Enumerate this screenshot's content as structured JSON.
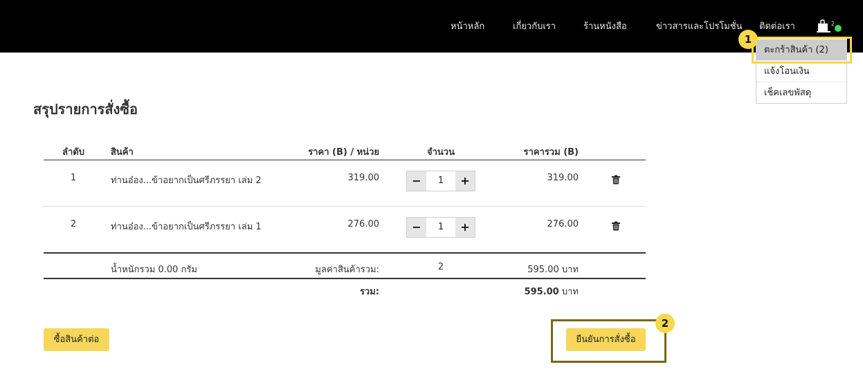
{
  "nav": {
    "items": [
      "หน้าหลัก",
      "เกี่ยวกับเรา",
      "ร้านหนังสือ",
      "ข่าวสารและโปรโมชั่น",
      "ติดต่อเรา"
    ],
    "cart_count": "2"
  },
  "dropdown": {
    "items": [
      "ตะกร้าสินค้า (2)",
      "แจ้งโอนเงิน",
      "เช็คเลขพัสดุ"
    ]
  },
  "annotations": {
    "badge1": "1",
    "badge2": "2"
  },
  "page": {
    "title": "สรุปรายการสั่งซื้อ"
  },
  "table": {
    "headers": [
      "ลำดับ",
      "สินค้า",
      "ราคา (B) / หน่วย",
      "จำนวน",
      "ราคารวม (B)"
    ],
    "rows": [
      {
        "index": "1",
        "product": "ท่านอ๋อง...ข้าอยากเป็นศรีภรรยา เล่ม 2",
        "price": "319.00",
        "qty": "1",
        "total": "319.00"
      },
      {
        "index": "2",
        "product": "ท่านอ๋อง...ข้าอยากเป็นศรีภรรยา เล่ม 1",
        "price": "276.00",
        "qty": "1",
        "total": "276.00"
      }
    ],
    "stepper_minus": "−",
    "stepper_plus": "+"
  },
  "summary": {
    "weight": "น้ำหนักรวม 0.00 กรัม",
    "subtotal_label": "มูลค่าสินค้ารวม:",
    "subtotal_qty": "2",
    "subtotal_amount": "595.00",
    "currency": "บาท",
    "total_label": "รวม:",
    "total_amount": "595.00"
  },
  "buttons": {
    "continue_shopping": "ซื้อสินค้าต่อ",
    "confirm_order": "ยืนยันการสั่งซื้อ"
  }
}
